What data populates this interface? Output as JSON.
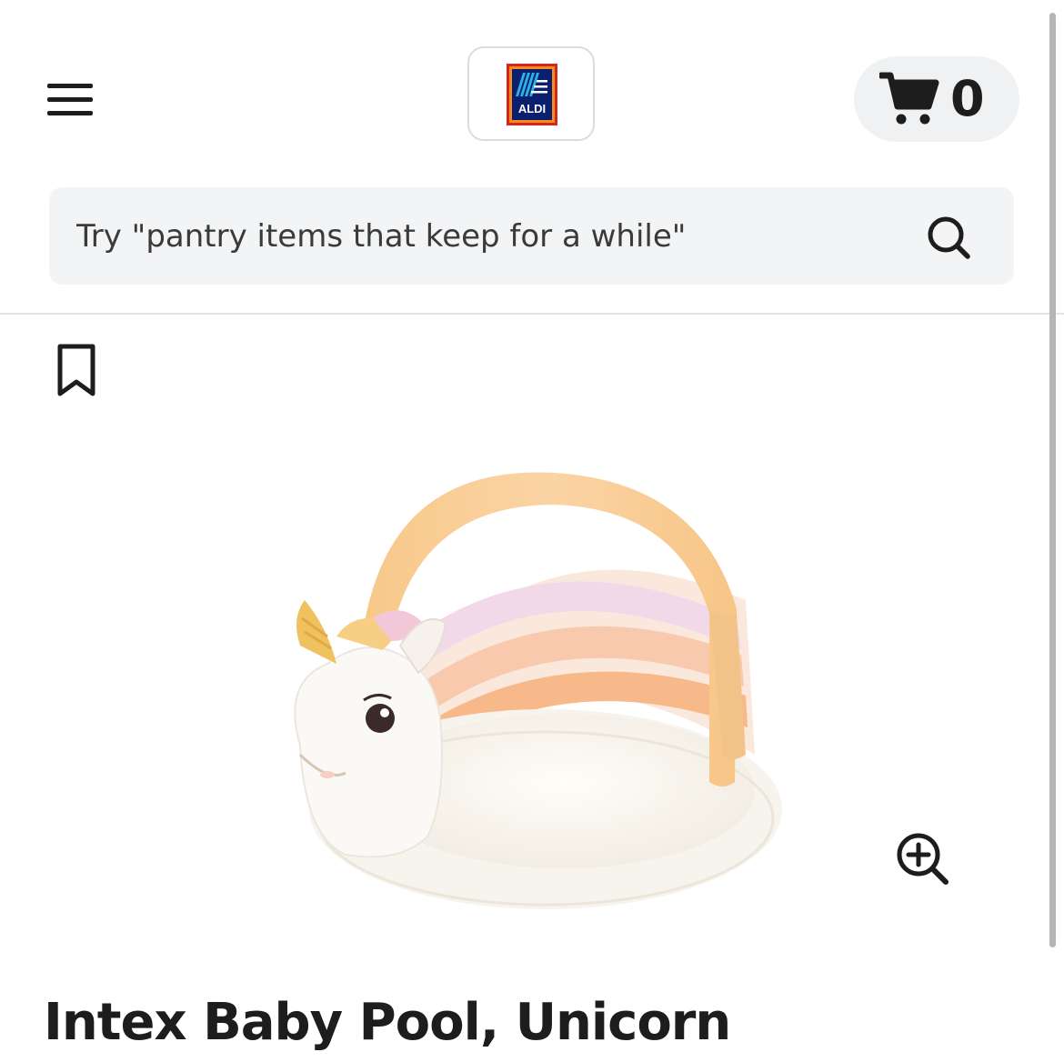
{
  "header": {
    "brand_name": "ALDI",
    "cart_count": "0"
  },
  "search": {
    "placeholder": "Try \"pantry items that keep for a while\""
  },
  "product": {
    "title": "Intex Baby Pool, Unicorn",
    "image_alt": "Intex Baby Pool, Unicorn"
  },
  "colors": {
    "aldi_navy": "#0a1f6e",
    "aldi_orange": "#f28c1e",
    "aldi_red": "#d6261c",
    "search_bg": "#f3f4f5",
    "cart_pill_bg": "#f0f1f2"
  },
  "icons": {
    "menu": "hamburger-menu-icon",
    "cart": "shopping-cart-icon",
    "search": "magnifier-icon",
    "bookmark": "bookmark-outline-icon",
    "zoom": "zoom-in-icon"
  }
}
